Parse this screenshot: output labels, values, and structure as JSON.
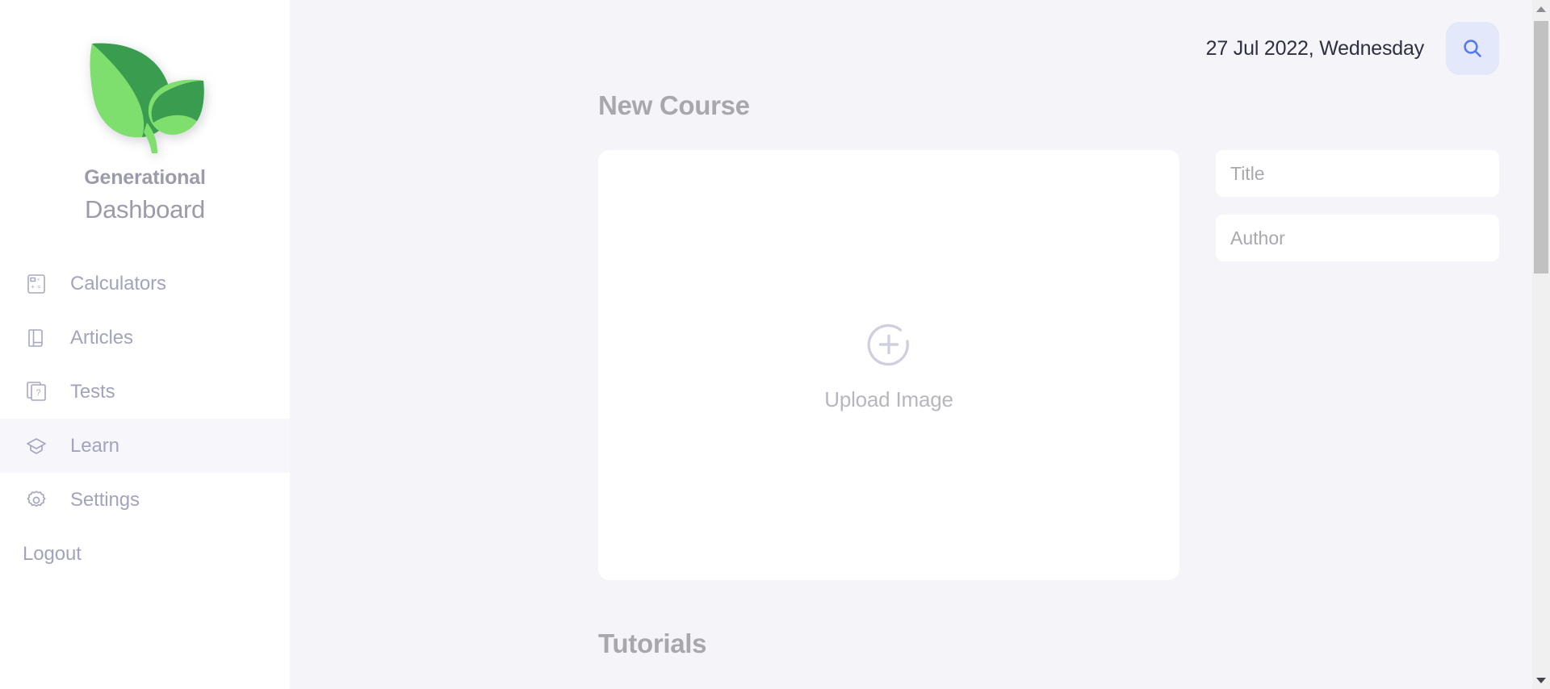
{
  "brand": {
    "logo_icon": "plant-leaf-logo",
    "name": "Generational",
    "subtitle": "Dashboard",
    "leaf_dark_color": "#3a9c4e",
    "leaf_light_color": "#7ede6e"
  },
  "sidebar": {
    "items": [
      {
        "label": "Calculators",
        "icon": "calculator-icon",
        "active": false
      },
      {
        "label": "Articles",
        "icon": "book-icon",
        "active": false
      },
      {
        "label": "Tests",
        "icon": "question-cards-icon",
        "active": false
      },
      {
        "label": "Learn",
        "icon": "graduation-cap-icon",
        "active": true
      },
      {
        "label": "Settings",
        "icon": "gear-icon",
        "active": false
      }
    ],
    "logout_label": "Logout",
    "active_item": "Learn",
    "active_bg_color": "#f6f6fb",
    "background_color": "#ffffff",
    "text_color": "#a3a3bd"
  },
  "header": {
    "date": "27 Jul 2022, Wednesday",
    "search_icon": "search-icon",
    "search_button_bg": "#e3e9fb",
    "search_icon_color": "#5579ef"
  },
  "main": {
    "page_title": "New Course",
    "background_color": "#f4f4f9",
    "upload": {
      "icon": "circle-plus-icon",
      "label": "Upload Image",
      "card_bg": "#ffffff"
    },
    "form": {
      "title_placeholder": "Title",
      "title_value": "",
      "author_placeholder": "Author",
      "author_value": ""
    },
    "tutorials_title": "Tutorials"
  },
  "scrollbar": {
    "up_arrow_icon": "chevron-up-icon",
    "down_arrow_icon": "chevron-down-icon",
    "thumb_color": "#c1c1c1",
    "track_color": "#f0f0f0"
  }
}
